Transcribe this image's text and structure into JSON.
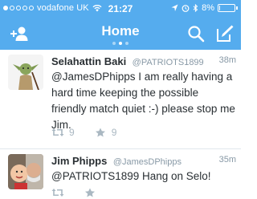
{
  "status_bar": {
    "carrier": "vodafone UK",
    "time": "21:27",
    "battery_percent": "8%",
    "battery_level": 0.08
  },
  "nav": {
    "title": "Home",
    "page_count": 3,
    "active_page": 1
  },
  "tweets": [
    {
      "name": "Selahattin Baki",
      "handle": "@PATRIOTS1899",
      "time": "38m",
      "text": "@JamesDPhipps I am really having a hard time keeping the possible friendly match quiet :-) please stop me Jim.",
      "retweets": "9",
      "favorites": "9"
    },
    {
      "name": "Jim Phipps",
      "handle": "@JamesDPhipps",
      "time": "35m",
      "text": "@PATRIOTS1899 Hang on Selo!"
    }
  ],
  "colors": {
    "brand": "#55acee",
    "text": "#292f33",
    "muted": "#8899a6",
    "icon": "#aab8c2"
  }
}
